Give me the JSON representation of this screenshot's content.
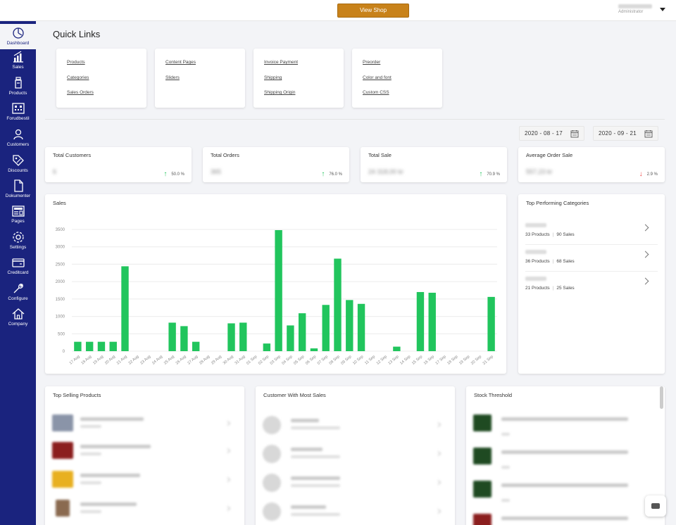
{
  "header": {
    "view_shop": "View Shop",
    "user_name": "",
    "user_role": "Administrator"
  },
  "sidebar": {
    "items": [
      {
        "label": "Dashboard",
        "icon": "dashboard-icon"
      },
      {
        "label": "Sales",
        "icon": "sales-icon"
      },
      {
        "label": "Products",
        "icon": "products-icon"
      },
      {
        "label": "Forudbestil",
        "icon": "forudbestil-icon"
      },
      {
        "label": "Customers",
        "icon": "customers-icon"
      },
      {
        "label": "Discounts",
        "icon": "discounts-icon"
      },
      {
        "label": "Dokumenter",
        "icon": "document-icon"
      },
      {
        "label": "Pages",
        "icon": "pages-icon"
      },
      {
        "label": "Settings",
        "icon": "settings-icon"
      },
      {
        "label": "Creditcard",
        "icon": "creditcard-icon"
      },
      {
        "label": "Configure",
        "icon": "wrench-icon"
      },
      {
        "label": "Company",
        "icon": "home-icon"
      }
    ]
  },
  "quick_links": {
    "title": "Quick Links",
    "cards": [
      [
        "Products",
        "Categories",
        "Sales Orders"
      ],
      [
        "Content Pages",
        "Sliders"
      ],
      [
        "Invoice Payment",
        "Shipping",
        "Shipping Origin"
      ],
      [
        "Preorder",
        "Color and font",
        "Custom CSS"
      ]
    ]
  },
  "dates": {
    "from": "2020 - 08 - 17",
    "to": "2020 - 09 - 21"
  },
  "stats": [
    {
      "title": "Total Customers",
      "value": "6",
      "pct": "50.0 %",
      "trend": "up"
    },
    {
      "title": "Total Orders",
      "value": "365",
      "pct": "76.0 %",
      "trend": "up"
    },
    {
      "title": "Total Sale",
      "value": "24 318,00 kr",
      "pct": "70.9 %",
      "trend": "up"
    },
    {
      "title": "Average Order Sale",
      "value": "557,23 kr",
      "pct": "2.9 %",
      "trend": "down"
    }
  ],
  "sales_panel": {
    "title": "Sales"
  },
  "chart_data": {
    "type": "bar",
    "title": "Sales",
    "categories": [
      "17 Aug",
      "18 Aug",
      "19 Aug",
      "20 Aug",
      "21 Aug",
      "22 Aug",
      "23 Aug",
      "24 Aug",
      "25 Aug",
      "26 Aug",
      "27 Aug",
      "28 Aug",
      "29 Aug",
      "30 Aug",
      "31 Aug",
      "01 Sep",
      "02 Sep",
      "03 Sep",
      "04 Sep",
      "05 Sep",
      "06 Sep",
      "07 Sep",
      "08 Sep",
      "09 Sep",
      "10 Sep",
      "11 Sep",
      "12 Sep",
      "13 Sep",
      "14 Sep",
      "15 Sep",
      "16 Sep",
      "17 Sep",
      "18 Sep",
      "19 Sep",
      "20 Sep",
      "21 Sep"
    ],
    "values": [
      270,
      270,
      270,
      270,
      2440,
      0,
      0,
      0,
      820,
      720,
      270,
      0,
      0,
      800,
      820,
      0,
      220,
      3480,
      740,
      1090,
      80,
      1330,
      2660,
      1470,
      1360,
      0,
      0,
      130,
      0,
      1700,
      1680,
      0,
      0,
      0,
      0,
      1560
    ],
    "yticks": [
      0,
      500,
      1000,
      1500,
      2000,
      2500,
      3000,
      3500
    ],
    "ylim": [
      0,
      3500
    ],
    "color": "#21c55d",
    "grid": true,
    "legend": "none"
  },
  "top_categories": {
    "title": "Top Performing Categories",
    "rows": [
      {
        "products": "33 Products",
        "sales": "90 Sales"
      },
      {
        "products": "36 Products",
        "sales": "68 Sales"
      },
      {
        "products": "21 Products",
        "sales": "25 Sales"
      }
    ]
  },
  "bottom_panels": {
    "top_selling": {
      "title": "Top Selling Products"
    },
    "top_customers": {
      "title": "Customer With Most Sales"
    },
    "stock": {
      "title": "Stock Threshold"
    }
  }
}
